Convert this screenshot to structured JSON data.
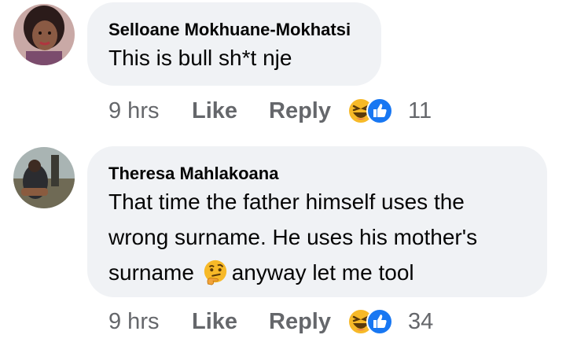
{
  "comments": [
    {
      "author": "Selloane Mokhuane-Mokhatsi",
      "text_lines": [
        "This is bull sh*t nje"
      ],
      "time": "9 hrs",
      "like_label": "Like",
      "reply_label": "Reply",
      "reaction_icons": [
        "haha-icon",
        "like-icon"
      ],
      "reaction_count": "11"
    },
    {
      "author": "Theresa Mahlakoana",
      "text_lines": [
        "That time the father himself uses the",
        "wrong surname. He uses his mother's"
      ],
      "text_line3_before": "surname",
      "text_line3_emoji": "thinking-face-icon",
      "text_line3_after": "anyway let me tool",
      "time": "9 hrs",
      "like_label": "Like",
      "reply_label": "Reply",
      "reaction_icons": [
        "haha-icon",
        "like-icon"
      ],
      "reaction_count": "34"
    }
  ],
  "colors": {
    "bubble": "#f0f2f5",
    "meta_text": "#65676b",
    "like_blue": "#1877f2",
    "haha_yellow": "#f7b928"
  }
}
